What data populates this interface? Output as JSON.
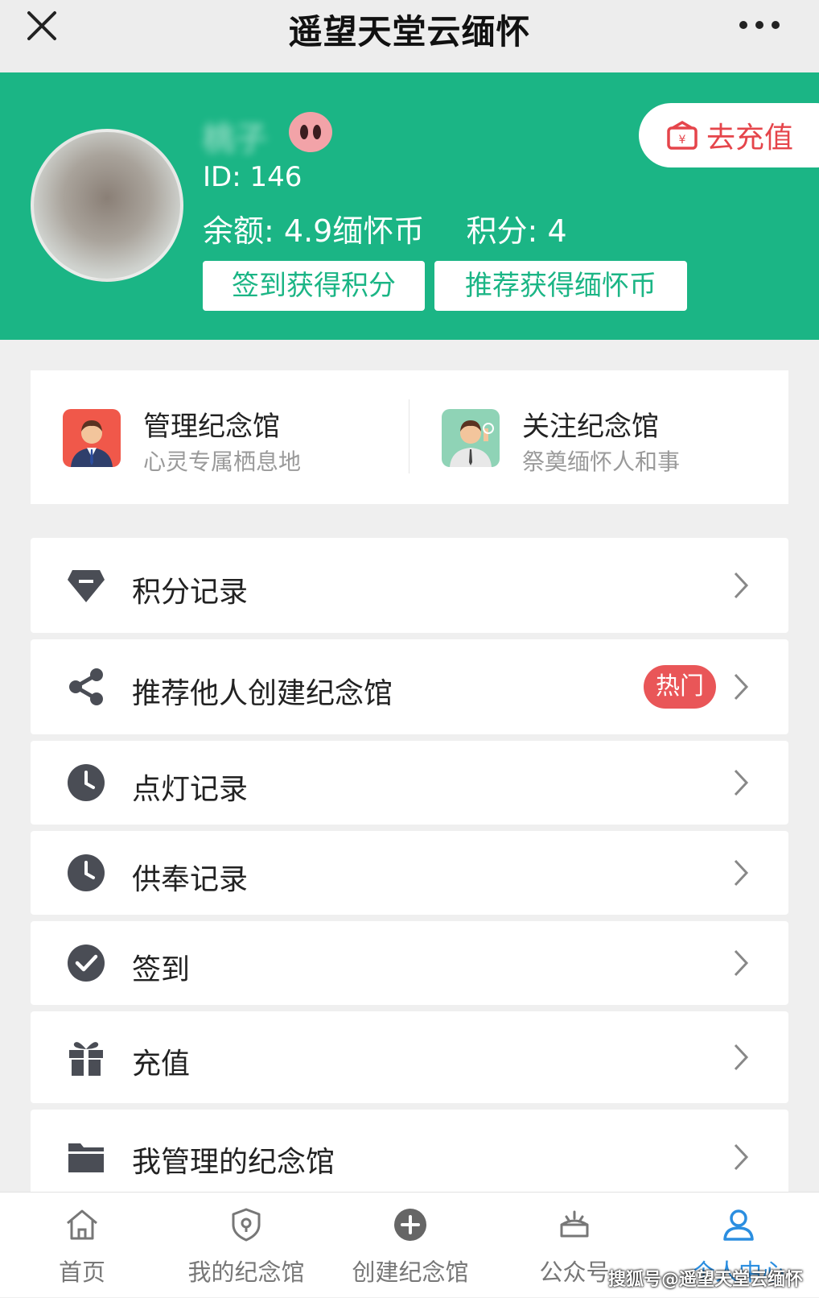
{
  "titlebar": {
    "title": "遥望天堂云缅怀",
    "close_icon": "close-icon",
    "more_icon": "more-icon"
  },
  "profile": {
    "nickname": "桃子",
    "id_text": "ID: 146",
    "balance_label": "余额:",
    "balance_value": "4.9缅怀币",
    "points_label": "积分:",
    "points_value": "4",
    "recharge_label": "去充值",
    "checkin_button": "签到获得积分",
    "recommend_button": "推荐获得缅怀币"
  },
  "shortcuts": [
    {
      "title": "管理纪念馆",
      "subtitle": "心灵专属栖息地"
    },
    {
      "title": "关注纪念馆",
      "subtitle": "祭奠缅怀人和事"
    }
  ],
  "menu": [
    {
      "label": "积分记录",
      "icon": "diamond-icon"
    },
    {
      "label": "推荐他人创建纪念馆",
      "icon": "share-icon",
      "badge": "热门"
    },
    {
      "label": "点灯记录",
      "icon": "clock-icon"
    },
    {
      "label": "供奉记录",
      "icon": "clock-icon"
    },
    {
      "label": "签到",
      "icon": "check-circle-icon"
    },
    {
      "label": "充值",
      "icon": "gift-icon"
    },
    {
      "label": "我管理的纪念馆",
      "icon": "folder-icon"
    }
  ],
  "tabs": [
    {
      "label": "首页",
      "icon": "home-icon"
    },
    {
      "label": "我的纪念馆",
      "icon": "shield-icon"
    },
    {
      "label": "创建纪念馆",
      "icon": "plus-circle-icon"
    },
    {
      "label": "公众号",
      "icon": "broadcast-icon"
    },
    {
      "label": "个人中心",
      "icon": "user-icon"
    }
  ],
  "watermark": "搜狐号@遥望天堂云缅怀",
  "colors": {
    "brand_green": "#1bb585",
    "badge_red": "#e95658",
    "active_tab": "#2b8ee0",
    "icon_dark": "#4a4d55"
  }
}
